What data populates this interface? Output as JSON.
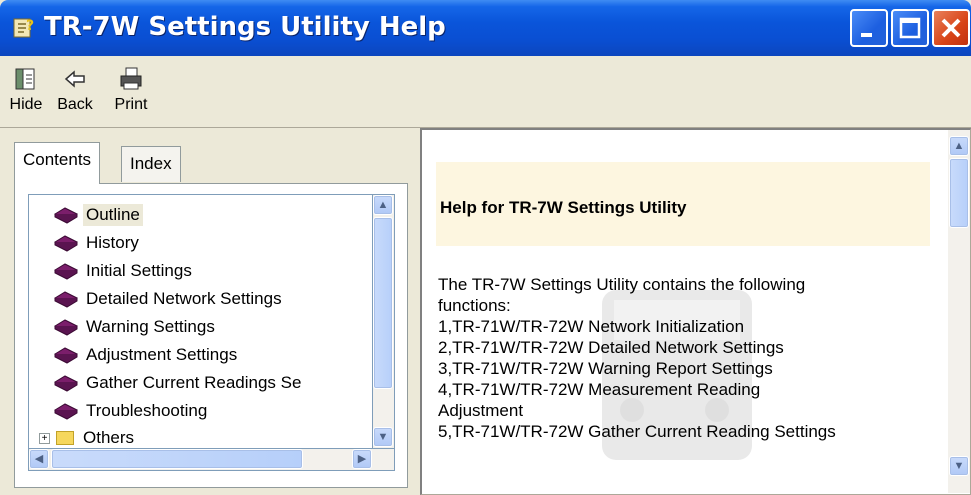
{
  "window": {
    "title": "TR-7W Settings Utility Help",
    "accent": "#0A55DA",
    "controls": [
      "minimize-icon",
      "maximize-icon",
      "close-icon"
    ]
  },
  "toolbar": {
    "hide_label": "Hide",
    "back_label": "Back",
    "print_label": "Print"
  },
  "tabs": {
    "contents_label": "Contents",
    "index_label": "Index"
  },
  "tree": {
    "items": [
      {
        "label": "Outline",
        "icon": "book-icon",
        "selected": true
      },
      {
        "label": "History",
        "icon": "book-icon"
      },
      {
        "label": "Initial Settings",
        "icon": "book-icon"
      },
      {
        "label": "Detailed Network Settings",
        "icon": "book-icon"
      },
      {
        "label": "Warning Settings",
        "icon": "book-icon"
      },
      {
        "label": "Adjustment Settings",
        "icon": "book-icon"
      },
      {
        "label": "Gather Current Readings Se",
        "icon": "book-icon"
      },
      {
        "label": "Troubleshooting",
        "icon": "book-icon"
      },
      {
        "label": "Others",
        "icon": "folder-icon",
        "expander": "+"
      }
    ]
  },
  "content": {
    "heading": "Help for TR-7W Settings Utility",
    "lines": [
      "The TR-7W Settings Utility contains the following",
      "functions:",
      "1,TR-71W/TR-72W Network Initialization",
      "2,TR-71W/TR-72W Detailed Network Settings",
      "3,TR-71W/TR-72W Warning Report Settings",
      "4,TR-71W/TR-72W Measurement Reading",
      "Adjustment",
      "5,TR-71W/TR-72W Gather Current Reading Settings"
    ]
  }
}
